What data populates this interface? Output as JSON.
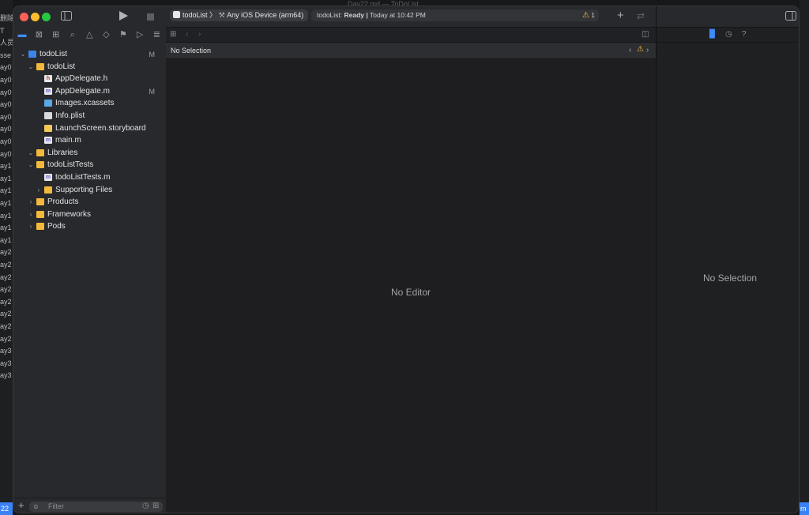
{
  "background": {
    "left_lines": [
      "删除",
      "T",
      "人员",
      "sse",
      "ay0",
      "ay0",
      "ay0",
      "ay0",
      "ay0",
      "ay0",
      "ay0",
      "ay0",
      "ay1",
      "ay1",
      "ay1",
      "ay1",
      "ay1",
      "ay1",
      "ay1",
      "ay2",
      "ay2",
      "ay2",
      "ay2",
      "ay2",
      "ay2",
      "ay2",
      "ay2",
      "ay3",
      "ay3",
      "ay3"
    ],
    "bottom_left": "22",
    "bottom_right": "m",
    "window_title": "Day22.md — ToDoList"
  },
  "toolbar": {
    "scheme_project": "todoList",
    "scheme_separator": "〉",
    "scheme_device": "Any iOS Device (arm64)",
    "activity_project": "todoList:",
    "activity_status": "Ready",
    "activity_separator": "|",
    "activity_time": "Today at 10:42 PM",
    "warning_count": "1",
    "add_icon": "plus-icon",
    "swap_icon": "swap-icon"
  },
  "navigator": {
    "tabs": [
      "folder-icon",
      "source-control-icon",
      "symbol-icon",
      "find-icon",
      "issue-icon",
      "test-icon",
      "debug-icon",
      "breakpoint-icon",
      "report-icon"
    ],
    "tree": [
      {
        "label": "todoList",
        "indent": 0,
        "chevron": "⌄",
        "icon": "proj",
        "status": "M"
      },
      {
        "label": "todoList",
        "indent": 1,
        "chevron": "⌄",
        "icon": "folder",
        "status": ""
      },
      {
        "label": "AppDelegate.h",
        "indent": 2,
        "chevron": "",
        "icon": "h",
        "status": ""
      },
      {
        "label": "AppDelegate.m",
        "indent": 2,
        "chevron": "",
        "icon": "m",
        "status": "M"
      },
      {
        "label": "Images.xcassets",
        "indent": 2,
        "chevron": "",
        "icon": "folder-blue",
        "status": ""
      },
      {
        "label": "Info.plist",
        "indent": 2,
        "chevron": "",
        "icon": "plist",
        "status": ""
      },
      {
        "label": "LaunchScreen.storyboard",
        "indent": 2,
        "chevron": "",
        "icon": "storyboard",
        "status": ""
      },
      {
        "label": "main.m",
        "indent": 2,
        "chevron": "",
        "icon": "m",
        "status": ""
      },
      {
        "label": "Libraries",
        "indent": 1,
        "chevron": "⌄",
        "icon": "folder",
        "status": ""
      },
      {
        "label": "todoListTests",
        "indent": 1,
        "chevron": "⌄",
        "icon": "folder",
        "status": ""
      },
      {
        "label": "todoListTests.m",
        "indent": 2,
        "chevron": "",
        "icon": "m",
        "status": ""
      },
      {
        "label": "Supporting Files",
        "indent": 2,
        "chevron": "›",
        "icon": "folder",
        "status": ""
      },
      {
        "label": "Products",
        "indent": 1,
        "chevron": "›",
        "icon": "folder",
        "status": ""
      },
      {
        "label": "Frameworks",
        "indent": 1,
        "chevron": "›",
        "icon": "folder",
        "status": ""
      },
      {
        "label": "Pods",
        "indent": 1,
        "chevron": "›",
        "icon": "folder",
        "status": ""
      }
    ],
    "filter_placeholder": "Filter"
  },
  "editor": {
    "selection_label": "No Selection",
    "empty_label": "No Editor"
  },
  "inspector": {
    "empty_label": "No Selection"
  },
  "colors": {
    "accent": "#3d8bfd",
    "warning": "#f5c242"
  }
}
